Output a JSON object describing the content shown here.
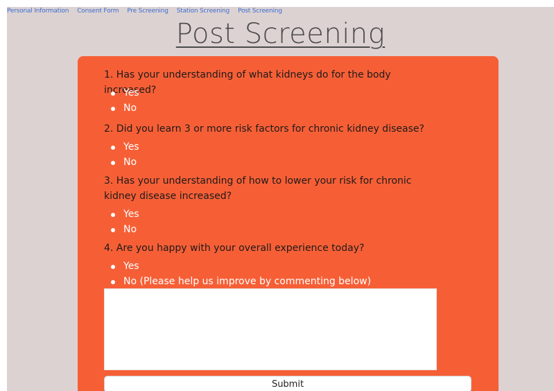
{
  "nav": {
    "links": [
      "Personal Information",
      "Consent Form",
      "Pre Screening",
      "Station Screening",
      "Post Screening"
    ]
  },
  "page_title": "Post Screening",
  "questions": [
    {
      "text": "1. Has your understanding of what kidneys do for the body increased?",
      "options": [
        "Yes",
        "No"
      ]
    },
    {
      "text": "2. Did you learn 3 or more risk factors for chronic kidney disease?",
      "options": [
        "Yes",
        "No"
      ]
    },
    {
      "text": "3. Has your understanding of how to lower your risk for chronic kidney disease increased?",
      "options": [
        "Yes",
        "No"
      ]
    },
    {
      "text": "4. Are you happy with your overall experience today?",
      "options": [
        "Yes",
        "No (Please help us improve by commenting below)"
      ]
    }
  ],
  "comment": {
    "value": "",
    "placeholder": ""
  },
  "submit_label": "Submit",
  "colors": {
    "background": "#ddd2d2",
    "card": "#f65f36",
    "link": "#3b6fd1"
  }
}
